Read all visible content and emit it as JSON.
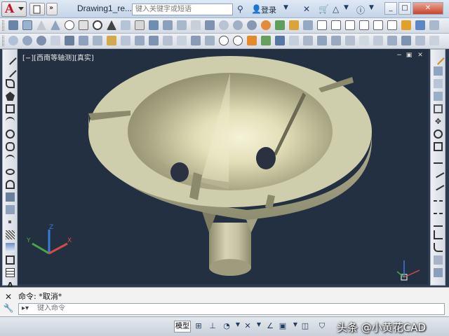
{
  "titlebar": {
    "app_logo": "A",
    "doc_title": "Drawing1_re...",
    "search_placeholder": "键入关键字或短语",
    "login_label": "登录"
  },
  "viewport": {
    "label": "[−][西南等轴测][真实]"
  },
  "ucs": {
    "x": "X",
    "y": "Y",
    "z": "Z"
  },
  "command": {
    "history": "命令: *取消*",
    "input_placeholder": "键入命令"
  },
  "status": {
    "model_label": "模型"
  },
  "watermark": "头条 @小黄花CAD",
  "colors": {
    "model_fill": "#c8c7a5",
    "background": "#223041"
  }
}
